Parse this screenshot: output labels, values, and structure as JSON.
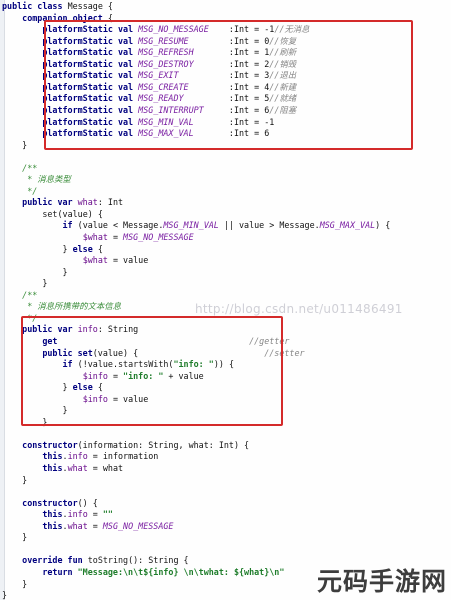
{
  "editor": {
    "language": "Kotlin",
    "lines": [
      [
        {
          "t": "kw",
          "v": "public class "
        },
        {
          "t": "text",
          "v": "Message {"
        }
      ],
      [
        {
          "t": "text",
          "v": "    "
        },
        {
          "t": "kw",
          "v": "companion object "
        },
        {
          "t": "text",
          "v": "{"
        }
      ],
      [
        {
          "t": "text",
          "v": "        "
        },
        {
          "t": "kw",
          "v": "platformStatic val "
        },
        {
          "t": "const",
          "v": "MSG_NO_MESSAGE"
        },
        {
          "t": "text",
          "v": "    :Int = -1"
        },
        {
          "t": "comment",
          "v": "//无消息"
        }
      ],
      [
        {
          "t": "text",
          "v": "        "
        },
        {
          "t": "kw",
          "v": "platformStatic val "
        },
        {
          "t": "const",
          "v": "MSG_RESUME"
        },
        {
          "t": "text",
          "v": "        :Int = 0"
        },
        {
          "t": "comment",
          "v": "//恢复"
        }
      ],
      [
        {
          "t": "text",
          "v": "        "
        },
        {
          "t": "kw",
          "v": "platformStatic val "
        },
        {
          "t": "const",
          "v": "MSG_REFRESH"
        },
        {
          "t": "text",
          "v": "       :Int = 1"
        },
        {
          "t": "comment",
          "v": "//刷新"
        }
      ],
      [
        {
          "t": "text",
          "v": "        "
        },
        {
          "t": "kw",
          "v": "platformStatic val "
        },
        {
          "t": "const",
          "v": "MSG_DESTROY"
        },
        {
          "t": "text",
          "v": "       :Int = 2"
        },
        {
          "t": "comment",
          "v": "//销毁"
        }
      ],
      [
        {
          "t": "text",
          "v": "        "
        },
        {
          "t": "kw",
          "v": "platformStatic val "
        },
        {
          "t": "const",
          "v": "MSG_EXIT"
        },
        {
          "t": "text",
          "v": "          :Int = 3"
        },
        {
          "t": "comment",
          "v": "//退出"
        }
      ],
      [
        {
          "t": "text",
          "v": "        "
        },
        {
          "t": "kw",
          "v": "platformStatic val "
        },
        {
          "t": "const",
          "v": "MSG_CREATE"
        },
        {
          "t": "text",
          "v": "        :Int = 4"
        },
        {
          "t": "comment",
          "v": "//新建"
        }
      ],
      [
        {
          "t": "text",
          "v": "        "
        },
        {
          "t": "kw",
          "v": "platformStatic val "
        },
        {
          "t": "const",
          "v": "MSG_READY"
        },
        {
          "t": "text",
          "v": "         :Int = 5"
        },
        {
          "t": "comment",
          "v": "//就绪"
        }
      ],
      [
        {
          "t": "text",
          "v": "        "
        },
        {
          "t": "kw",
          "v": "platformStatic val "
        },
        {
          "t": "const",
          "v": "MSG_INTERRUPT"
        },
        {
          "t": "text",
          "v": "     :Int = 6"
        },
        {
          "t": "comment",
          "v": "//阻塞"
        }
      ],
      [
        {
          "t": "text",
          "v": "        "
        },
        {
          "t": "kw",
          "v": "platformStatic val "
        },
        {
          "t": "const",
          "v": "MSG_MIN_VAL"
        },
        {
          "t": "text",
          "v": "       :Int = -1"
        }
      ],
      [
        {
          "t": "text",
          "v": "        "
        },
        {
          "t": "kw",
          "v": "platformStatic val "
        },
        {
          "t": "const",
          "v": "MSG_MAX_VAL"
        },
        {
          "t": "text",
          "v": "       :Int = 6"
        }
      ],
      [
        {
          "t": "text",
          "v": "    }"
        }
      ],
      [
        {
          "t": "text",
          "v": ""
        }
      ],
      [
        {
          "t": "text",
          "v": "    "
        },
        {
          "t": "doc",
          "v": "/**"
        }
      ],
      [
        {
          "t": "text",
          "v": "     "
        },
        {
          "t": "doc",
          "v": "* 消息类型"
        }
      ],
      [
        {
          "t": "text",
          "v": "     "
        },
        {
          "t": "doc",
          "v": "*/"
        }
      ],
      [
        {
          "t": "text",
          "v": "    "
        },
        {
          "t": "kw",
          "v": "public var "
        },
        {
          "t": "field",
          "v": "what"
        },
        {
          "t": "text",
          "v": ": Int"
        }
      ],
      [
        {
          "t": "text",
          "v": "        "
        },
        {
          "t": "fn",
          "v": "set"
        },
        {
          "t": "text",
          "v": "(value) {"
        }
      ],
      [
        {
          "t": "text",
          "v": "            "
        },
        {
          "t": "kw",
          "v": "if "
        },
        {
          "t": "text",
          "v": "(value < Message."
        },
        {
          "t": "const",
          "v": "MSG_MIN_VAL"
        },
        {
          "t": "text",
          "v": " || value > Message."
        },
        {
          "t": "const",
          "v": "MSG_MAX_VAL"
        },
        {
          "t": "text",
          "v": ") {"
        }
      ],
      [
        {
          "t": "text",
          "v": "                "
        },
        {
          "t": "field",
          "v": "$what"
        },
        {
          "t": "text",
          "v": " = "
        },
        {
          "t": "const",
          "v": "MSG_NO_MESSAGE"
        }
      ],
      [
        {
          "t": "text",
          "v": "            } "
        },
        {
          "t": "kw",
          "v": "else "
        },
        {
          "t": "text",
          "v": "{"
        }
      ],
      [
        {
          "t": "text",
          "v": "                "
        },
        {
          "t": "field",
          "v": "$what"
        },
        {
          "t": "text",
          "v": " = value"
        }
      ],
      [
        {
          "t": "text",
          "v": "            }"
        }
      ],
      [
        {
          "t": "text",
          "v": "        }"
        }
      ],
      [
        {
          "t": "text",
          "v": "    "
        },
        {
          "t": "doc",
          "v": "/**"
        }
      ],
      [
        {
          "t": "text",
          "v": "     "
        },
        {
          "t": "doc",
          "v": "* 消息所携带的文本信息"
        }
      ],
      [
        {
          "t": "text",
          "v": "     "
        },
        {
          "t": "doc",
          "v": "*/"
        }
      ],
      [
        {
          "t": "text",
          "v": "    "
        },
        {
          "t": "kw",
          "v": "public var "
        },
        {
          "t": "field",
          "v": "info"
        },
        {
          "t": "text",
          "v": ": String"
        }
      ],
      [
        {
          "t": "text",
          "v": "        "
        },
        {
          "t": "kw",
          "v": "get"
        },
        {
          "t": "text",
          "v": "                                      "
        },
        {
          "t": "comment",
          "v": "//getter"
        }
      ],
      [
        {
          "t": "text",
          "v": "        "
        },
        {
          "t": "kw",
          "v": "public set"
        },
        {
          "t": "text",
          "v": "(value) {"
        },
        {
          "t": "text",
          "v": "                         "
        },
        {
          "t": "comment",
          "v": "//setter"
        }
      ],
      [
        {
          "t": "text",
          "v": "            "
        },
        {
          "t": "kw",
          "v": "if "
        },
        {
          "t": "text",
          "v": "(!value."
        },
        {
          "t": "fn",
          "v": "startsWith"
        },
        {
          "t": "text",
          "v": "("
        },
        {
          "t": "str",
          "v": "\"info: \""
        },
        {
          "t": "text",
          "v": ")) {"
        }
      ],
      [
        {
          "t": "text",
          "v": "                "
        },
        {
          "t": "field",
          "v": "$info"
        },
        {
          "t": "text",
          "v": " = "
        },
        {
          "t": "str",
          "v": "\"info: \""
        },
        {
          "t": "text",
          "v": " + value"
        }
      ],
      [
        {
          "t": "text",
          "v": "            } "
        },
        {
          "t": "kw",
          "v": "else "
        },
        {
          "t": "text",
          "v": "{"
        }
      ],
      [
        {
          "t": "text",
          "v": "                "
        },
        {
          "t": "field",
          "v": "$info"
        },
        {
          "t": "text",
          "v": " = value"
        }
      ],
      [
        {
          "t": "text",
          "v": "            }"
        }
      ],
      [
        {
          "t": "text",
          "v": "        }"
        }
      ],
      [
        {
          "t": "text",
          "v": ""
        }
      ],
      [
        {
          "t": "text",
          "v": "    "
        },
        {
          "t": "kw",
          "v": "constructor"
        },
        {
          "t": "text",
          "v": "(information: String, what: Int) {"
        }
      ],
      [
        {
          "t": "text",
          "v": "        "
        },
        {
          "t": "kw",
          "v": "this"
        },
        {
          "t": "text",
          "v": "."
        },
        {
          "t": "field",
          "v": "info"
        },
        {
          "t": "text",
          "v": " = information"
        }
      ],
      [
        {
          "t": "text",
          "v": "        "
        },
        {
          "t": "kw",
          "v": "this"
        },
        {
          "t": "text",
          "v": "."
        },
        {
          "t": "field",
          "v": "what"
        },
        {
          "t": "text",
          "v": " = what"
        }
      ],
      [
        {
          "t": "text",
          "v": "    }"
        }
      ],
      [
        {
          "t": "text",
          "v": ""
        }
      ],
      [
        {
          "t": "text",
          "v": "    "
        },
        {
          "t": "kw",
          "v": "constructor"
        },
        {
          "t": "text",
          "v": "() {"
        }
      ],
      [
        {
          "t": "text",
          "v": "        "
        },
        {
          "t": "kw",
          "v": "this"
        },
        {
          "t": "text",
          "v": "."
        },
        {
          "t": "field",
          "v": "info"
        },
        {
          "t": "text",
          "v": " = "
        },
        {
          "t": "str",
          "v": "\"\""
        }
      ],
      [
        {
          "t": "text",
          "v": "        "
        },
        {
          "t": "kw",
          "v": "this"
        },
        {
          "t": "text",
          "v": "."
        },
        {
          "t": "field",
          "v": "what"
        },
        {
          "t": "text",
          "v": " = "
        },
        {
          "t": "const",
          "v": "MSG_NO_MESSAGE"
        }
      ],
      [
        {
          "t": "text",
          "v": "    }"
        }
      ],
      [
        {
          "t": "text",
          "v": ""
        }
      ],
      [
        {
          "t": "text",
          "v": "    "
        },
        {
          "t": "kw",
          "v": "override fun "
        },
        {
          "t": "fn",
          "v": "toString"
        },
        {
          "t": "text",
          "v": "(): String {"
        }
      ],
      [
        {
          "t": "text",
          "v": "        "
        },
        {
          "t": "kw",
          "v": "return "
        },
        {
          "t": "str",
          "v": "\"Message:\\n\\t${info} \\n\\twhat: ${what}\\n\""
        }
      ],
      [
        {
          "t": "text",
          "v": "    }"
        }
      ],
      [
        {
          "t": "text",
          "v": "}"
        }
      ]
    ]
  },
  "watermark": "http://blog.csdn.net/u011486491",
  "brand": "元码手游网",
  "colors": {
    "highlight_box": "#d42a2a",
    "keyword": "#00007f",
    "constant": "#7a1fa2",
    "string": "#1f7d2b",
    "comment": "#868686"
  }
}
